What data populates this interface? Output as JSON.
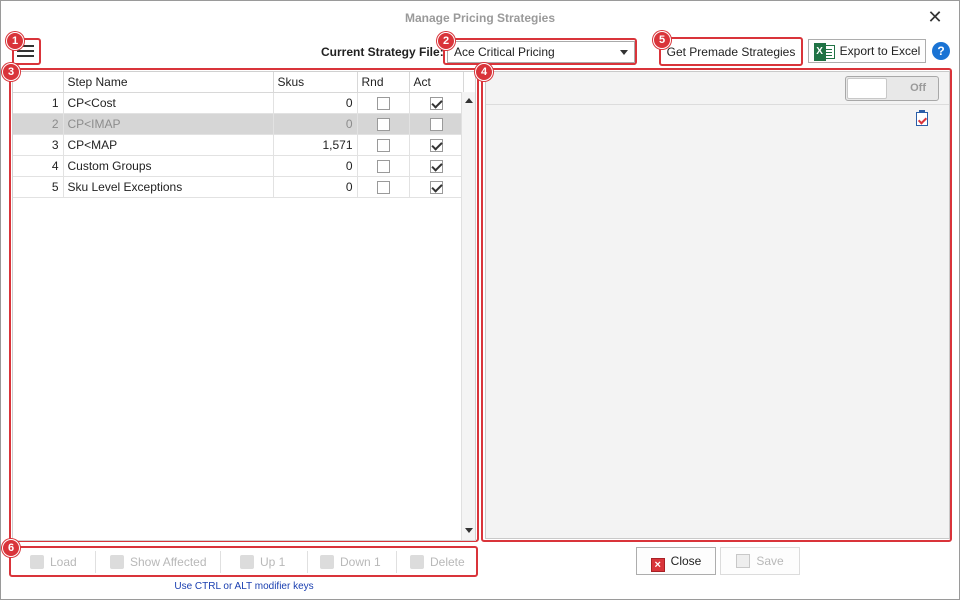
{
  "window": {
    "title": "Manage Pricing Strategies"
  },
  "header": {
    "strategy_label": "Current Strategy File:",
    "strategy_value": "Ace Critical Pricing",
    "premade_label": "Get Premade Strategies",
    "export_label": "Export to Excel",
    "help_glyph": "?"
  },
  "grid": {
    "columns": [
      "",
      "Step Name",
      "Skus",
      "Rnd",
      "Act"
    ],
    "rows": [
      {
        "num": "1",
        "name": "CP<Cost",
        "skus": "0",
        "rnd": false,
        "act": true,
        "inactive": false
      },
      {
        "num": "2",
        "name": "CP<IMAP",
        "skus": "0",
        "rnd": false,
        "act": false,
        "inactive": true
      },
      {
        "num": "3",
        "name": "CP<MAP",
        "skus": "1,571",
        "rnd": false,
        "act": true,
        "inactive": false
      },
      {
        "num": "4",
        "name": "Custom Groups",
        "skus": "0",
        "rnd": false,
        "act": true,
        "inactive": false
      },
      {
        "num": "5",
        "name": "Sku Level Exceptions",
        "skus": "0",
        "rnd": false,
        "act": true,
        "inactive": false
      }
    ]
  },
  "detail": {
    "toggle_label": "Off"
  },
  "toolbar": {
    "load": "Load",
    "show_affected": "Show Affected",
    "up": "Up 1",
    "down": "Down 1",
    "delete": "Delete",
    "hint": "Use CTRL or ALT modifier keys"
  },
  "footer": {
    "close": "Close",
    "save": "Save"
  },
  "callouts": [
    "1",
    "2",
    "3",
    "4",
    "5",
    "6"
  ],
  "colors": {
    "callout": "#d9343a",
    "hint": "#1a3fb0",
    "help": "#1a73d4",
    "excel": "#1f7244"
  },
  "icons": [
    "hamburger-menu-icon",
    "excel-icon",
    "help-icon",
    "clipboard-check-icon",
    "close-icon",
    "save-icon"
  ]
}
